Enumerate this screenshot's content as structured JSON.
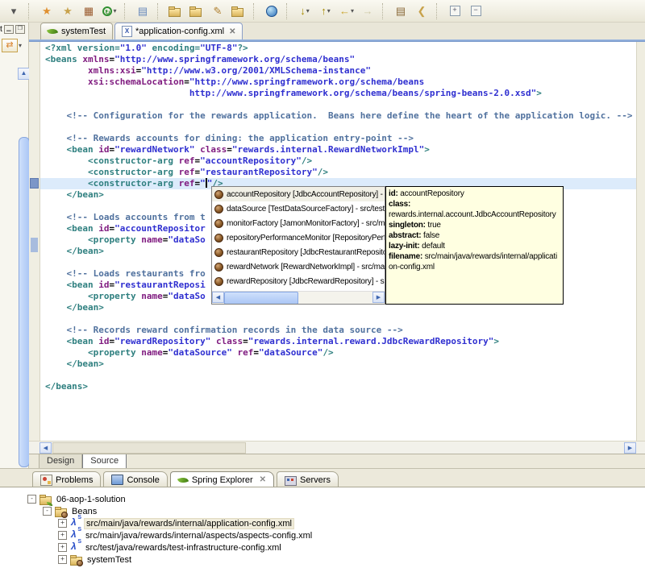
{
  "colors": {
    "tag": "#2E7F7F",
    "attribute": "#7F1A7F",
    "value": "#2F2FD0",
    "comment": "#50719E",
    "tooltip_bg": "#FFFFE1",
    "current_line": "#DCEBFB",
    "selection_blue": "#AAC6F5"
  },
  "toolbar": {
    "items": [
      {
        "kind": "icon",
        "name": "toolbar-overflow-caret",
        "glyph": "▾",
        "color": "#555"
      },
      {
        "kind": "sep",
        "name": "toolbar-separator"
      },
      {
        "kind": "icon",
        "name": "new-wizard-icon",
        "glyph": "★",
        "color": "#E09030"
      },
      {
        "kind": "icon",
        "name": "new-wizard-alt-icon",
        "glyph": "★",
        "color": "#C8A24B"
      },
      {
        "kind": "icon",
        "name": "debug-grid-icon",
        "glyph": "▦",
        "color": "#9A5B2F"
      },
      {
        "kind": "run",
        "name": "run-icon",
        "glyph": "↻",
        "caret": true
      },
      {
        "kind": "sep",
        "name": "toolbar-separator"
      },
      {
        "kind": "icon",
        "name": "open-type-icon",
        "glyph": "▤",
        "color": "#6688BB"
      },
      {
        "kind": "sep",
        "name": "toolbar-separator"
      },
      {
        "kind": "folder",
        "name": "open-perspective-icon"
      },
      {
        "kind": "folder",
        "name": "open-resource-icon"
      },
      {
        "kind": "icon",
        "name": "mark-occurrences-pencil-icon",
        "glyph": "✎",
        "color": "#B08030"
      },
      {
        "kind": "folder",
        "name": "open-file-icon"
      },
      {
        "kind": "sep",
        "name": "toolbar-separator"
      },
      {
        "kind": "globe",
        "name": "web-browser-icon"
      },
      {
        "kind": "sep",
        "name": "toolbar-separator"
      },
      {
        "kind": "icon",
        "name": "next-annotation-icon",
        "glyph": "↓",
        "color": "#A88A00",
        "caret": true
      },
      {
        "kind": "icon",
        "name": "previous-annotation-icon",
        "glyph": "↑",
        "color": "#A88A00",
        "caret": true
      },
      {
        "kind": "icon",
        "name": "back-nav-icon",
        "glyph": "←",
        "color": "#C9A227",
        "caret": true
      },
      {
        "kind": "icon",
        "name": "forward-nav-icon",
        "glyph": "→",
        "color": "#CFC9A8"
      },
      {
        "kind": "sep",
        "name": "toolbar-separator"
      },
      {
        "kind": "icon",
        "name": "last-edit-location-icon",
        "glyph": "▤",
        "color": "#8A6A3A"
      },
      {
        "kind": "icon",
        "name": "tag-icon",
        "glyph": "❮",
        "color": "#C8A24B"
      },
      {
        "kind": "sep",
        "name": "toolbar-separator"
      },
      {
        "kind": "box",
        "name": "expand-all-icon",
        "glyph": "+"
      },
      {
        "kind": "box",
        "name": "collapse-all-icon",
        "glyph": "−"
      }
    ]
  },
  "left_strip": {
    "title": "t",
    "minimize_glyph": "▁",
    "restore_glyph": "❐",
    "sync_glyph": "⇄",
    "scroll_up_glyph": "▲"
  },
  "editor_tabs": [
    {
      "label": "systemTest",
      "icon": "leaf",
      "active": false,
      "closable": false
    },
    {
      "label": "*application-config.xml",
      "icon": "xml",
      "active": true,
      "closable": true,
      "close_glyph": "✕"
    }
  ],
  "editor": {
    "current_line_index": 12,
    "lines": [
      {
        "tokens": [
          [
            "t",
            "<?xml version="
          ],
          [
            "v",
            "\"1.0\""
          ],
          [
            "t",
            " encoding="
          ],
          [
            "v",
            "\"UTF-8\""
          ],
          [
            "t",
            "?>"
          ]
        ]
      },
      {
        "tokens": [
          [
            "t",
            "<beans "
          ],
          [
            "a",
            "xmlns"
          ],
          [
            "p",
            "="
          ],
          [
            "v",
            "\"http://www.springframework.org/schema/beans\""
          ]
        ]
      },
      {
        "tokens": [
          [
            "p",
            "        "
          ],
          [
            "a",
            "xmlns:xsi"
          ],
          [
            "p",
            "="
          ],
          [
            "v",
            "\"http://www.w3.org/2001/XMLSchema-instance\""
          ]
        ]
      },
      {
        "tokens": [
          [
            "p",
            "        "
          ],
          [
            "a",
            "xsi:schemaLocation"
          ],
          [
            "p",
            "="
          ],
          [
            "v",
            "\"http://www.springframework.org/schema/beans"
          ]
        ]
      },
      {
        "tokens": [
          [
            "p",
            "                           "
          ],
          [
            "v",
            "http://www.springframework.org/schema/beans/spring-beans-2.0.xsd\""
          ],
          [
            "t",
            ">"
          ]
        ]
      },
      {
        "tokens": []
      },
      {
        "tokens": [
          [
            "p",
            "    "
          ],
          [
            "c",
            "<!-- Configuration for the rewards application.  Beans here define the heart of the application logic. -->"
          ]
        ]
      },
      {
        "tokens": []
      },
      {
        "tokens": [
          [
            "p",
            "    "
          ],
          [
            "c",
            "<!-- Rewards accounts for dining: the application entry-point -->"
          ]
        ]
      },
      {
        "tokens": [
          [
            "p",
            "    "
          ],
          [
            "t",
            "<bean "
          ],
          [
            "a",
            "id"
          ],
          [
            "p",
            "="
          ],
          [
            "v",
            "\"rewardNetwork\""
          ],
          [
            "p",
            " "
          ],
          [
            "a",
            "class"
          ],
          [
            "p",
            "="
          ],
          [
            "v",
            "\"rewards.internal.RewardNetworkImpl\""
          ],
          [
            "t",
            ">"
          ]
        ]
      },
      {
        "tokens": [
          [
            "p",
            "        "
          ],
          [
            "t",
            "<constructor-arg "
          ],
          [
            "a",
            "ref"
          ],
          [
            "p",
            "="
          ],
          [
            "v",
            "\"accountRepository\""
          ],
          [
            "t",
            "/>"
          ]
        ]
      },
      {
        "tokens": [
          [
            "p",
            "        "
          ],
          [
            "t",
            "<constructor-arg "
          ],
          [
            "a",
            "ref"
          ],
          [
            "p",
            "="
          ],
          [
            "v",
            "\"restaurantRepository\""
          ],
          [
            "t",
            "/>"
          ]
        ]
      },
      {
        "tokens": [
          [
            "p",
            "        "
          ],
          [
            "t",
            "<constructor-arg "
          ],
          [
            "a",
            "ref"
          ],
          [
            "p",
            "="
          ],
          [
            "v",
            "\""
          ],
          [
            "caret",
            ""
          ],
          [
            "v",
            "\""
          ],
          [
            "t",
            "/>"
          ]
        ]
      },
      {
        "tokens": [
          [
            "p",
            "    "
          ],
          [
            "t",
            "</bean>"
          ]
        ]
      },
      {
        "tokens": []
      },
      {
        "tokens": [
          [
            "p",
            "    "
          ],
          [
            "c",
            "<!-- Loads accounts from t"
          ]
        ]
      },
      {
        "tokens": [
          [
            "p",
            "    "
          ],
          [
            "t",
            "<bean "
          ],
          [
            "a",
            "id"
          ],
          [
            "p",
            "="
          ],
          [
            "v",
            "\"accountRepositor"
          ]
        ]
      },
      {
        "tokens": [
          [
            "p",
            "        "
          ],
          [
            "t",
            "<property "
          ],
          [
            "a",
            "name"
          ],
          [
            "p",
            "="
          ],
          [
            "v",
            "\"dataSo"
          ]
        ]
      },
      {
        "tokens": [
          [
            "p",
            "    "
          ],
          [
            "t",
            "</bean>"
          ]
        ]
      },
      {
        "tokens": []
      },
      {
        "tokens": [
          [
            "p",
            "    "
          ],
          [
            "c",
            "<!-- Loads restaurants fro"
          ]
        ]
      },
      {
        "tokens": [
          [
            "p",
            "    "
          ],
          [
            "t",
            "<bean "
          ],
          [
            "a",
            "id"
          ],
          [
            "p",
            "="
          ],
          [
            "v",
            "\"restaurantReposi"
          ]
        ]
      },
      {
        "tokens": [
          [
            "p",
            "        "
          ],
          [
            "t",
            "<property "
          ],
          [
            "a",
            "name"
          ],
          [
            "p",
            "="
          ],
          [
            "v",
            "\"dataSo"
          ]
        ]
      },
      {
        "tokens": [
          [
            "p",
            "    "
          ],
          [
            "t",
            "</bean>"
          ]
        ]
      },
      {
        "tokens": []
      },
      {
        "tokens": [
          [
            "p",
            "    "
          ],
          [
            "c",
            "<!-- Records reward confirmation records in the data source -->"
          ]
        ]
      },
      {
        "tokens": [
          [
            "p",
            "    "
          ],
          [
            "t",
            "<bean "
          ],
          [
            "a",
            "id"
          ],
          [
            "p",
            "="
          ],
          [
            "v",
            "\"rewardRepository\""
          ],
          [
            "p",
            " "
          ],
          [
            "a",
            "class"
          ],
          [
            "p",
            "="
          ],
          [
            "v",
            "\"rewards.internal.reward.JdbcRewardRepository\""
          ],
          [
            "t",
            ">"
          ]
        ]
      },
      {
        "tokens": [
          [
            "p",
            "        "
          ],
          [
            "t",
            "<property "
          ],
          [
            "a",
            "name"
          ],
          [
            "p",
            "="
          ],
          [
            "v",
            "\"dataSource\""
          ],
          [
            "p",
            " "
          ],
          [
            "a",
            "ref"
          ],
          [
            "p",
            "="
          ],
          [
            "v",
            "\"dataSource\""
          ],
          [
            "t",
            "/>"
          ]
        ]
      },
      {
        "tokens": [
          [
            "p",
            "    "
          ],
          [
            "t",
            "</bean>"
          ]
        ]
      },
      {
        "tokens": []
      },
      {
        "tokens": [
          [
            "t",
            "</beans>"
          ]
        ]
      }
    ]
  },
  "completion": {
    "selected_index": 0,
    "items": [
      "accountRepository [JdbcAccountRepository] - src",
      "dataSource [TestDataSourceFactory] - src/test/ja",
      "monitorFactory [JamonMonitorFactory] - src/main",
      "repositoryPerformanceMonitor [RepositoryPerfor",
      "restaurantRepository [JdbcRestaurantRepository",
      "rewardNetwork [RewardNetworkImpl] - src/main/j",
      "rewardRepository [JdbcRewardRepository] - src/r"
    ],
    "scroll_left_glyph": "◀",
    "scroll_right_glyph": "▶"
  },
  "tooltip": {
    "fields": [
      {
        "label": "id:",
        "value": "accountRepository",
        "value_on_new_line": false
      },
      {
        "label": "class:",
        "value": "rewards.internal.account.JdbcAccountRepository",
        "value_on_new_line": true
      },
      {
        "label": "singleton:",
        "value": "true",
        "value_on_new_line": false
      },
      {
        "label": "abstract:",
        "value": "false",
        "value_on_new_line": false
      },
      {
        "label": "lazy-init:",
        "value": "default",
        "value_on_new_line": false
      },
      {
        "label": "filename:",
        "value": "src/main/java/rewards/internal/application-config.xml",
        "value_on_new_line": false
      }
    ]
  },
  "hscroll": {
    "left_glyph": "◀",
    "right_glyph": "▶"
  },
  "page_tabs": [
    {
      "label": "Design",
      "active": false
    },
    {
      "label": "Source",
      "active": true
    }
  ],
  "view_tabs": [
    {
      "label": "Problems",
      "icon": "problems",
      "active": false,
      "closable": false
    },
    {
      "label": "Console",
      "icon": "console",
      "active": false,
      "closable": false
    },
    {
      "label": "Spring Explorer",
      "icon": "leaf",
      "active": true,
      "closable": true,
      "close_glyph": "✕"
    },
    {
      "label": "Servers",
      "icon": "servers",
      "active": false,
      "closable": false
    }
  ],
  "tree": {
    "items": [
      {
        "label": "06-aop-1-solution",
        "level": 0,
        "expander": "-",
        "icon": "folder-leaf",
        "selected": false
      },
      {
        "label": "Beans",
        "level": 1,
        "expander": "-",
        "icon": "folder-bean",
        "selected": false
      },
      {
        "label": "src/main/java/rewards/internal/application-config.xml",
        "level": 2,
        "expander": "+",
        "icon": "springcfg",
        "selected": true
      },
      {
        "label": "src/main/java/rewards/internal/aspects/aspects-config.xml",
        "level": 2,
        "expander": "+",
        "icon": "springcfg",
        "selected": false
      },
      {
        "label": "src/test/java/rewards/test-infrastructure-config.xml",
        "level": 2,
        "expander": "+",
        "icon": "springcfg",
        "selected": false
      },
      {
        "label": "systemTest",
        "level": 2,
        "expander": "+",
        "icon": "folder-bean",
        "selected": false
      }
    ]
  }
}
